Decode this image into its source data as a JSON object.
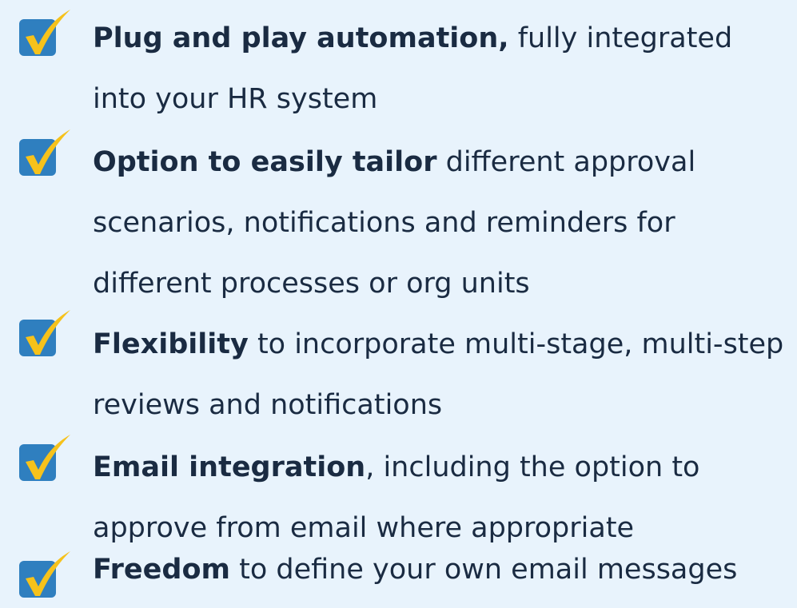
{
  "items": [
    {
      "bold": "Plug and play automation,",
      "rest": " fully integrated into your HR system"
    },
    {
      "bold": "Option to easily tailor",
      "rest": " different approval scenarios, notifications and reminders for different processes or org units"
    },
    {
      "bold": "Flexibility",
      "rest": " to incorporate multi-stage, multi-step reviews and notifications"
    },
    {
      "bold": "Email integration",
      "rest": ", including the option to approve from email where appropriate"
    },
    {
      "bold": "Freedom",
      "rest": " to define your own email messages"
    }
  ],
  "icon": "checkbox-checked-icon",
  "colors": {
    "background": "#e8f3fc",
    "text": "#1a2b42",
    "box": "#2f7fbf",
    "check": "#f6c21b"
  }
}
